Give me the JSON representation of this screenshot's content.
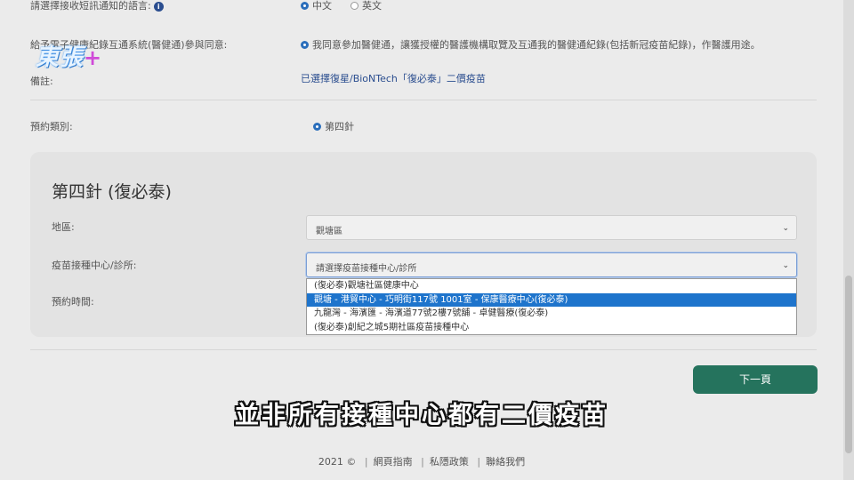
{
  "brand": {
    "logo_text": "東張",
    "logo_plus": "+"
  },
  "form": {
    "notify_lang_label": "請選擇接收短訊通知的語言:",
    "notify_lang_options": [
      "中文",
      "英文"
    ],
    "consent_label": "給予電子健康紀錄互通系統(醫健通)參與同意:",
    "consent_text": "我同意參加醫健通，讓獲授權的醫護機構取覽及互通我的醫健通紀錄(包括新冠疫苗紀錄)，作醫護用途。",
    "remark_label": "備註:",
    "remark_value": "已選擇復星/BioNTech「復必泰」二價疫苗",
    "booking_type_label": "預約類別:",
    "booking_type_value": "第四針"
  },
  "card": {
    "title": "第四針 (復必泰)",
    "district_label": "地區:",
    "district_value": "觀塘區",
    "centre_label": "疫苗接種中心/診所:",
    "centre_placeholder": "請選擇疫苗接種中心/診所",
    "time_label": "預約時間:",
    "centre_options": [
      "(復必泰)觀塘社區健康中心",
      "觀塘 - 港貿中心 - 巧明街117號 1001室 - 保康醫療中心(復必泰)",
      "九龍灣 - 海濱匯 - 海濱道77號2樓7號舖 - 卓健醫療(復必泰)",
      "(復必泰)創紀之城5期社區疫苗接種中心"
    ],
    "selected_option_index": 1
  },
  "next_button": "下一頁",
  "subtitle": "並非所有接種中心都有二價疫苗",
  "footer": {
    "copyright": "2021 ©",
    "links": [
      "網頁指南",
      "私隱政策",
      "聯絡我們"
    ]
  }
}
